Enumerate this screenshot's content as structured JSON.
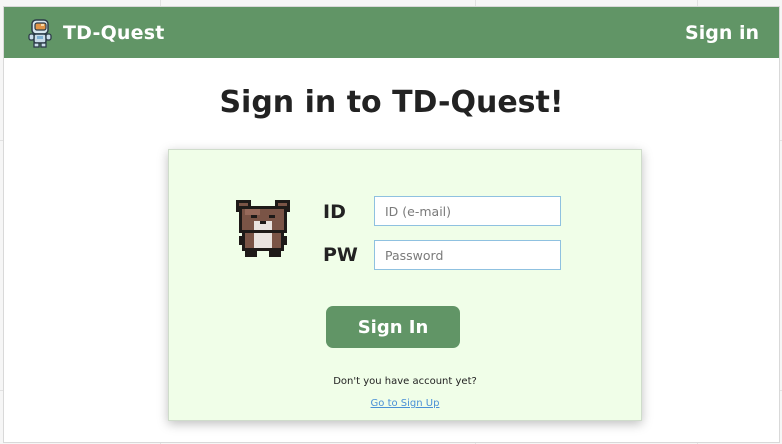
{
  "navbar": {
    "brand_name": "TD-Quest",
    "brand_icon": "astronaut-logo-icon",
    "signin_label": "Sign in",
    "background_color": "#619566"
  },
  "main": {
    "title": "Sign in to TD-Quest!"
  },
  "login_form": {
    "mascot_icon": "pixel-bear-icon",
    "id_label": "ID",
    "id_placeholder": "ID (e-mail)",
    "pw_label": "PW",
    "pw_placeholder": "Password",
    "submit_label": "Sign In",
    "no_account_text": "Don't you have account yet?",
    "signup_link_text": "Go to Sign Up",
    "card_color": "#f0fee8",
    "button_color": "#619566",
    "link_color": "#4a90d6"
  }
}
